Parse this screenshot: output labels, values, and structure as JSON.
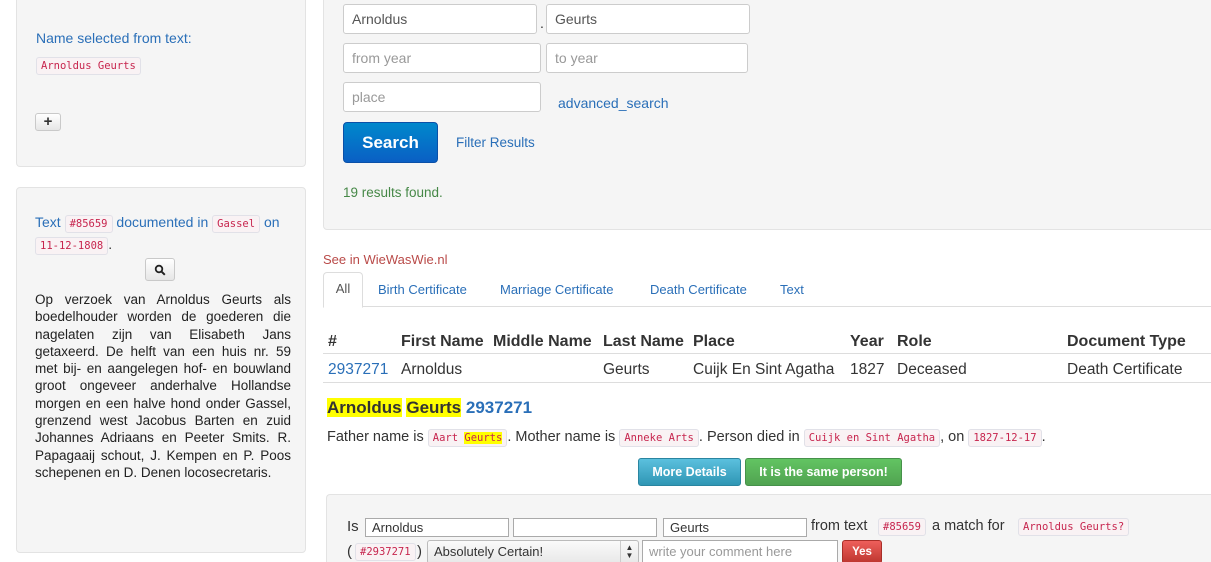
{
  "sidebar": {
    "name_heading": "Name selected from text:",
    "name_code": "Arnoldus Geurts",
    "add_glyph": "+",
    "text_prefix": "Text",
    "text_id": "#85659",
    "documented_in": "documented in",
    "place": "Gassel",
    "on": "on",
    "date": "11-12-1808",
    "period": ".",
    "search_glyph": "search-icon",
    "body": "Op verzoek van Arnoldus Geurts als boedelhouder worden de goederen die nagelaten zijn van Elisabeth Jans getaxeerd. De helft van een huis nr. 59 met bij- en aangelegen hof- en bouwland groot ongeveer anderhalve Hollandse morgen en een halve hond onder Gassel, grenzend west Jacobus Barten en zuid Johannes Adriaans en Peeter Smits. R. Papagaaij schout, J. Kempen en P. Poos schepenen en D. Denen locosecretaris."
  },
  "search": {
    "first_name": "Arnoldus",
    "separator": ".",
    "last_name": "Geurts",
    "from_year_placeholder": "from year",
    "to_year_placeholder": "to year",
    "place_placeholder": "place",
    "advanced_link": "advanced_search",
    "search_button": "Search",
    "filter_link": "Filter Results",
    "results_text": "19 results found."
  },
  "results": {
    "see_in": "See in WieWasWie.nl",
    "tabs": [
      "All",
      "Birth Certificate",
      "Marriage Certificate",
      "Death Certificate",
      "Text"
    ],
    "active_tab": 0,
    "columns": [
      "#",
      "First Name",
      "Middle Name",
      "Last Name",
      "Place",
      "Year",
      "Role",
      "Document Type"
    ],
    "rows": [
      {
        "id": "2937271",
        "first": "Arnoldus",
        "middle": "",
        "last": "Geurts",
        "place": "Cuijk En Sint Agatha",
        "year": "1827",
        "role": "Deceased",
        "doc": "Death Certificate"
      }
    ]
  },
  "detail": {
    "first": "Arnoldus",
    "last": "Geurts",
    "id": "2937271",
    "father_label": "Father name is",
    "father_first": "Aart",
    "father_last": "Geurts",
    "mother_label": ". Mother name is",
    "mother": "Anneke Arts",
    "died_label": ". Person died in",
    "died_place": "Cuijk en Sint Agatha",
    "on_label": ", on",
    "died_date": "1827-12-17",
    "end": ".",
    "more_details": "More Details",
    "same_person": "It is the same person!"
  },
  "match": {
    "is_label": "Is",
    "first": "Arnoldus",
    "middle": "",
    "last": "Geurts",
    "from_text_label": "from text",
    "text_id": "#85659",
    "match_label": "a match for",
    "name": "Arnoldus Geurts?",
    "open_paren": "(",
    "record_id": "#2937271",
    "close_paren": ")",
    "certainty": "Absolutely Certain!",
    "comment_placeholder": "write your comment here",
    "yes_button": "Yes"
  },
  "colors": {
    "link": "#2a6fb8",
    "search_button": "#0a5fc4",
    "info_button": "#49afcd",
    "success_button": "#5bb75b",
    "danger_button": "#da4f49",
    "results_green": "#468847",
    "see_in_red": "#b94a48",
    "highlight": "#ffff00"
  }
}
